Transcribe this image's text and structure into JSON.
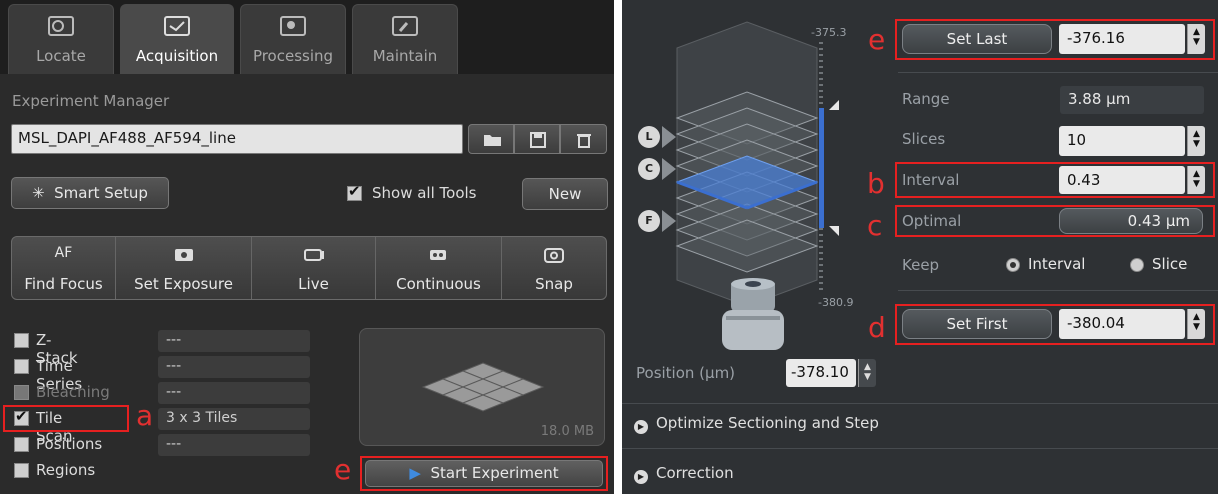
{
  "left": {
    "tabs": [
      {
        "label": "Locate",
        "icon": "locate-icon"
      },
      {
        "label": "Acquisition",
        "icon": "acquisition-icon"
      },
      {
        "label": "Processing",
        "icon": "processing-icon"
      },
      {
        "label": "Maintain",
        "icon": "maintain-icon"
      }
    ],
    "experiment_manager": {
      "label": "Experiment Manager",
      "value": "MSL_DAPI_AF488_AF594_line"
    },
    "smart_setup_label": "Smart Setup",
    "show_all_tools_label": "Show all Tools",
    "new_label": "New",
    "acquisition_buttons": [
      {
        "top": "AF",
        "label": "Find Focus"
      },
      {
        "top": "",
        "label": "Set Exposure"
      },
      {
        "top": "",
        "label": "Live"
      },
      {
        "top": "",
        "label": "Continuous"
      },
      {
        "top": "",
        "label": "Snap"
      }
    ],
    "tools": [
      {
        "name": "Z-Stack",
        "value": "---",
        "checked": false,
        "enabled": true
      },
      {
        "name": "Time Series",
        "value": "---",
        "checked": false,
        "enabled": true
      },
      {
        "name": "Bleaching",
        "value": "---",
        "checked": false,
        "enabled": false
      },
      {
        "name": "Tile Scan",
        "value": "3 x 3 Tiles",
        "checked": true,
        "enabled": true
      },
      {
        "name": "Positions",
        "value": "---",
        "checked": false,
        "enabled": true
      },
      {
        "name": "Regions",
        "value": "",
        "checked": false,
        "enabled": true
      }
    ],
    "data_size": "18.0 MB",
    "start_experiment_label": "Start Experiment",
    "annotations": {
      "a": "a",
      "e": "e"
    }
  },
  "right": {
    "scale_top": "-375.3",
    "scale_bottom": "-380.9",
    "markers": [
      "L",
      "C",
      "F"
    ],
    "set_last_label": "Set Last",
    "set_last_value": "-376.16",
    "range_label": "Range",
    "range_value": "3.88 µm",
    "slices_label": "Slices",
    "slices_value": "10",
    "interval_label": "Interval",
    "interval_value": "0.43",
    "optimal_label": "Optimal",
    "optimal_value": "0.43 µm",
    "keep_label": "Keep",
    "keep_options": [
      "Interval",
      "Slice"
    ],
    "keep_selected": "Interval",
    "set_first_label": "Set First",
    "set_first_value": "-380.04",
    "position_label": "Position (µm)",
    "position_value": "-378.10",
    "expanders": [
      "Optimize Sectioning and Step",
      "Correction"
    ],
    "annotations": {
      "e": "e",
      "b": "b",
      "c": "c",
      "d": "d"
    }
  },
  "colors": {
    "highlight": "#e62020",
    "slice_highlight": "#4a7fd6",
    "panel": "#2b2b2b"
  }
}
